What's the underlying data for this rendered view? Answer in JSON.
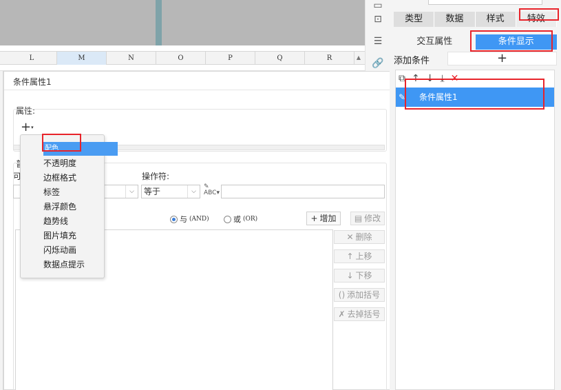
{
  "sheet": {
    "columns": [
      {
        "label": "L",
        "selected": false
      },
      {
        "label": "M",
        "selected": true
      },
      {
        "label": "N",
        "selected": false
      },
      {
        "label": "O",
        "selected": false
      },
      {
        "label": "P",
        "selected": false
      },
      {
        "label": "Q",
        "selected": false
      },
      {
        "label": "R",
        "selected": false
      }
    ]
  },
  "dialog": {
    "title": "条件属性1",
    "property_label": "属性:",
    "partial_label": "普",
    "partial_label2": "可",
    "operator_label": "操作符:",
    "operator_value": "等于",
    "and_label": "与",
    "and_code": "(AND)",
    "or_label": "或",
    "or_code": "(OR)",
    "add_button": "增加",
    "modify_button": "修改",
    "delete_button": "删除",
    "move_up_button": "上移",
    "move_down_button": "下移",
    "add_bracket_button": "添加括号",
    "remove_bracket_button": "去掉括号"
  },
  "popup_menu": {
    "items": [
      {
        "label": "配色",
        "selected": true
      },
      {
        "label": "不透明度",
        "selected": false
      },
      {
        "label": "边框格式",
        "selected": false
      },
      {
        "label": "标签",
        "selected": false
      },
      {
        "label": "悬浮颜色",
        "selected": false
      },
      {
        "label": "趋势线",
        "selected": false
      },
      {
        "label": "图片填充",
        "selected": false
      },
      {
        "label": "闪烁动画",
        "selected": false
      },
      {
        "label": "数据点提示",
        "selected": false
      }
    ]
  },
  "right_panel": {
    "tabs": [
      "类型",
      "数据",
      "样式",
      "特效"
    ],
    "active_tab": "特效",
    "subtabs": [
      "交互属性",
      "条件显示"
    ],
    "active_subtab": "条件显示",
    "add_condition_label": "添加条件",
    "add_condition_plus": "+",
    "condition_items": [
      "条件属性1"
    ]
  },
  "colors": {
    "accent": "#3f97f4",
    "highlight": "#e8232a"
  }
}
